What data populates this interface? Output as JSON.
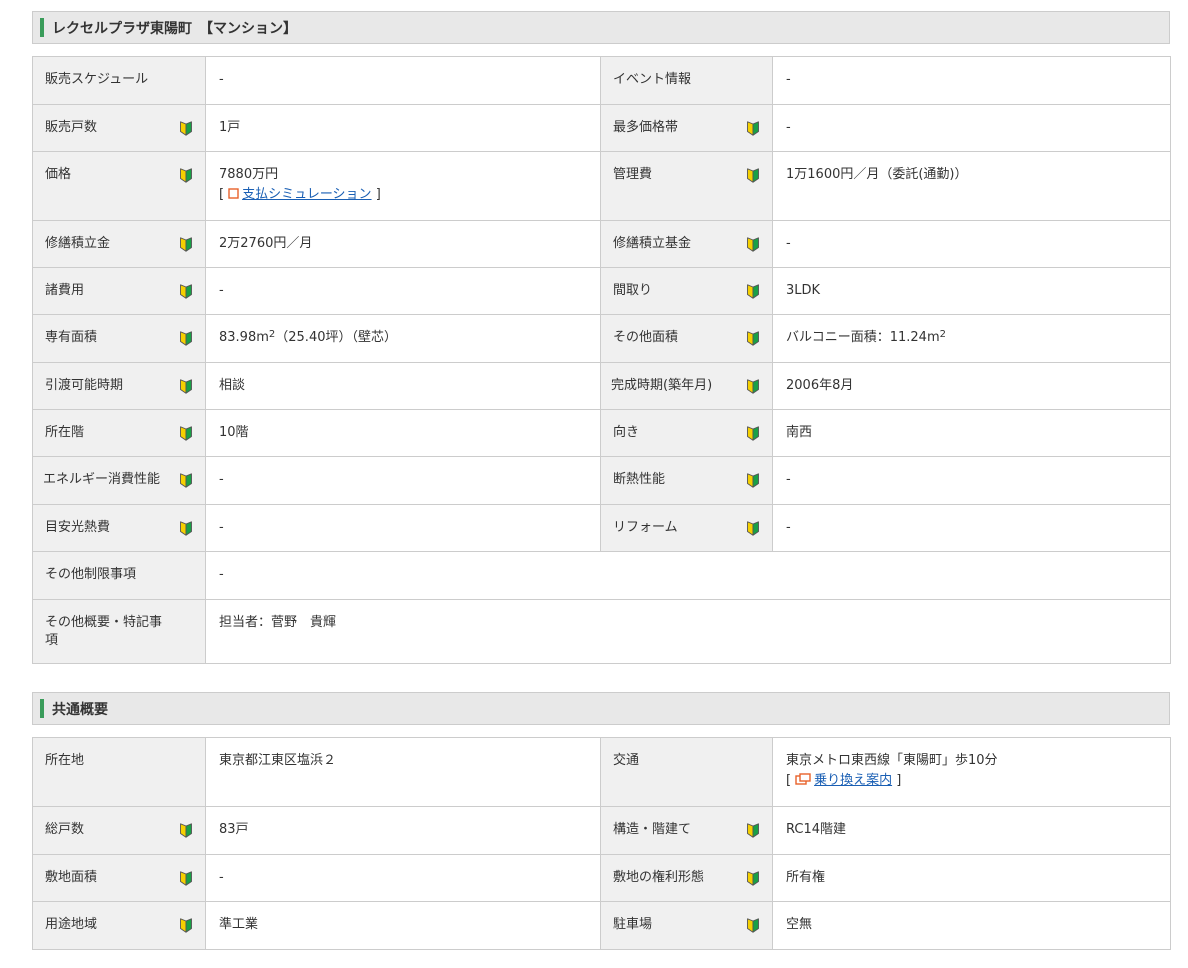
{
  "sections": [
    {
      "title": "レクセルプラザ東陽町　【マンション】",
      "rows": [
        [
          {
            "label": "販売スケジュール",
            "beginner": false,
            "value": "-"
          },
          {
            "label": "イベント情報",
            "beginner": false,
            "value": "-"
          }
        ],
        [
          {
            "label": "販売戸数",
            "beginner": true,
            "value": "1戸"
          },
          {
            "label": "最多価格帯",
            "beginner": true,
            "value": "-"
          }
        ],
        [
          {
            "label": "価格",
            "beginner": true,
            "value": "7880万円",
            "link": {
              "text": "支払シミュレーション",
              "icon": "square-icon"
            }
          },
          {
            "label": "管理費",
            "beginner": true,
            "value": "1万1600円／月（委託(通勤)）"
          }
        ],
        [
          {
            "label": "修繕積立金",
            "beginner": true,
            "value": "2万2760円／月"
          },
          {
            "label": "修繕積立基金",
            "beginner": true,
            "value": "-"
          }
        ],
        [
          {
            "label": "諸費用",
            "beginner": true,
            "value": "-"
          },
          {
            "label": "間取り",
            "beginner": true,
            "value": "3LDK"
          }
        ],
        [
          {
            "label": "専有面積",
            "beginner": true,
            "value": "83.98m",
            "value_sup": "2",
            "value_after": "（25.40坪）（壁芯）"
          },
          {
            "label": "その他面積",
            "beginner": true,
            "value": "バルコニー面積：11.24m",
            "value_sup": "2"
          }
        ],
        [
          {
            "label": "引渡可能時期",
            "beginner": true,
            "value": "相談"
          },
          {
            "label": "完成時期(築年月)",
            "beginner": true,
            "value": "2006年8月"
          }
        ],
        [
          {
            "label": "所在階",
            "beginner": true,
            "value": "10階"
          },
          {
            "label": "向き",
            "beginner": true,
            "value": "南西"
          }
        ],
        [
          {
            "label": "エネルギー消費性能",
            "beginner": true,
            "value": "-"
          },
          {
            "label": "断熱性能",
            "beginner": true,
            "value": "-"
          }
        ],
        [
          {
            "label": "目安光熱費",
            "beginner": true,
            "value": "-"
          },
          {
            "label": "リフォーム",
            "beginner": true,
            "value": "-"
          }
        ],
        [
          {
            "label": "その他制限事項",
            "beginner": false,
            "value": "-",
            "span": true
          }
        ],
        [
          {
            "label": "その他概要・特記事項",
            "beginner": false,
            "value": "担当者：菅野　貴輝",
            "span": true
          }
        ]
      ]
    },
    {
      "title": "共通概要",
      "rows": [
        [
          {
            "label": "所在地",
            "beginner": false,
            "value": "東京都江東区塩浜２"
          },
          {
            "label": "交通",
            "beginner": false,
            "value": "東京メトロ東西線「東陽町」歩10分",
            "link": {
              "text": "乗り換え案内",
              "icon": "window-icon"
            }
          }
        ],
        [
          {
            "label": "総戸数",
            "beginner": true,
            "value": "83戸"
          },
          {
            "label": "構造・階建て",
            "beginner": true,
            "value": "RC14階建"
          }
        ],
        [
          {
            "label": "敷地面積",
            "beginner": true,
            "value": "-"
          },
          {
            "label": "敷地の権利形態",
            "beginner": true,
            "value": "所有権"
          }
        ],
        [
          {
            "label": "用途地域",
            "beginner": true,
            "value": "準工業"
          },
          {
            "label": "駐車場",
            "beginner": true,
            "value": "空無"
          }
        ]
      ]
    }
  ],
  "colors": {
    "accent": "#3a9c5a",
    "header_bg": "#e8e8e8",
    "label_bg": "#f0f0f0",
    "border": "#cccccc",
    "link": "#1a5fb4",
    "icon_orange": "#e8622a"
  }
}
